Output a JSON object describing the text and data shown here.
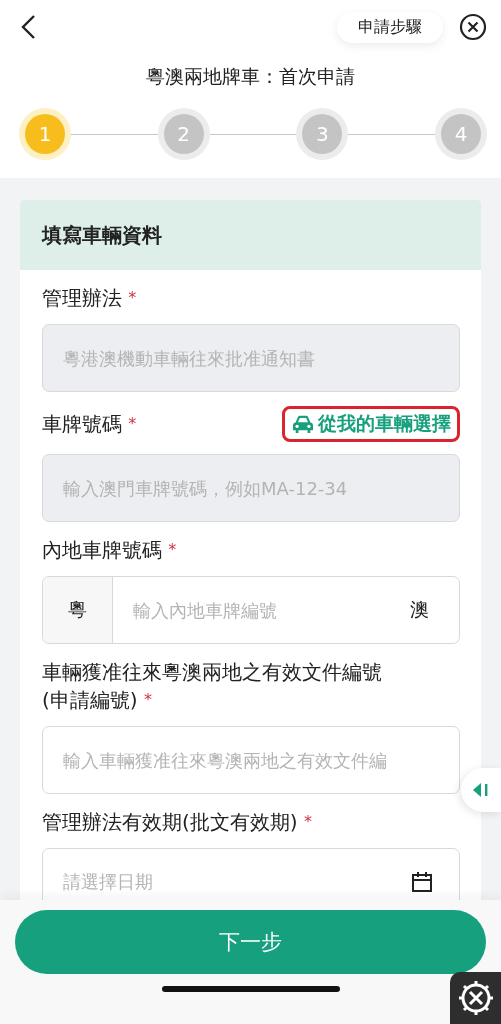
{
  "header": {
    "steps_button": "申請步驟"
  },
  "title": "粵澳兩地牌車：首次申請",
  "steps": [
    {
      "number": "1",
      "selected": true
    },
    {
      "number": "2",
      "selected": false
    },
    {
      "number": "3",
      "selected": false
    },
    {
      "number": "4",
      "selected": false
    }
  ],
  "section": {
    "title": "填寫車輛資料",
    "fields": [
      {
        "kind": "text",
        "label": "管理辦法",
        "required_mark": "*",
        "placeholder": "粵港澳機動車輛往來批准通知書",
        "disabled": true
      },
      {
        "kind": "text",
        "label": "車牌號碼",
        "required_mark": "*",
        "placeholder": "輸入澳門車牌號碼，例如MA-12-34",
        "disabled": true,
        "action": "從我的車輛選擇"
      },
      {
        "kind": "plate",
        "label": "內地車牌號碼",
        "required_mark": "*",
        "prefix": "粵",
        "placeholder": "輸入內地車牌編號",
        "suffix": "澳",
        "disabled": false
      },
      {
        "kind": "text",
        "label": "車輛獲准往來粵澳兩地之有效文件編號(申請編號)",
        "required_mark": "*",
        "placeholder": "輸入車輛獲准往來粵澳兩地之有效文件編",
        "disabled": false
      },
      {
        "kind": "date",
        "label": "管理辦法有效期(批文有效期)",
        "required_mark": "*",
        "placeholder": "請選擇日期",
        "disabled": false
      }
    ]
  },
  "next_button": "下一步"
}
